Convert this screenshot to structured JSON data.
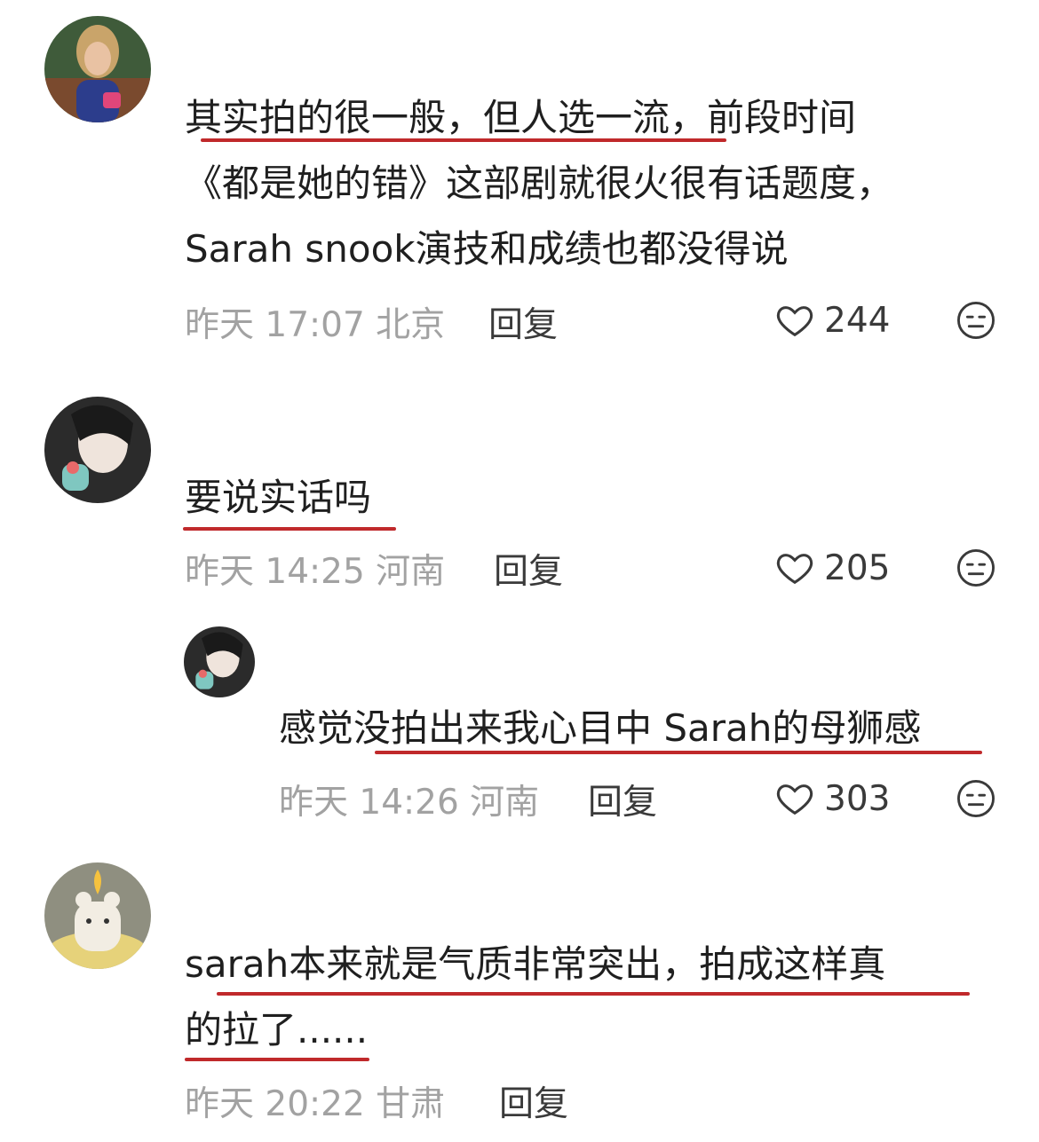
{
  "comments": [
    {
      "lines": [
        "其实拍的很一般，但人选一流，前段时间",
        "《都是她的错》这部剧就很火很有话题度，",
        "Sarah snook演技和成绩也都没得说"
      ],
      "time": "昨天 17:07 北京",
      "reply": "回复",
      "likes": "244"
    },
    {
      "lines": [
        "要说实话吗"
      ],
      "time": "昨天 14:25 河南",
      "reply": "回复",
      "likes": "205"
    },
    {
      "lines": [
        "感觉没拍出来我心目中 Sarah的母狮感"
      ],
      "time": "昨天 14:26 河南",
      "reply": "回复",
      "likes": "303"
    },
    {
      "lines": [
        "sarah本来就是气质非常突出，拍成这样真",
        "的拉了......"
      ],
      "time": "昨天 20:22 甘肃",
      "reply": "回复"
    }
  ],
  "icons": {
    "like": "heart-outline-icon",
    "dislike": "neutral-face-icon"
  },
  "colors": {
    "underline": "#c0292b",
    "meta": "#a2a2a2"
  }
}
